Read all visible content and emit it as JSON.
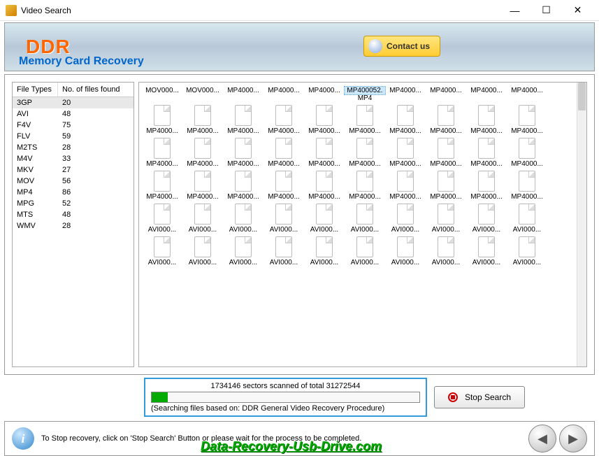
{
  "titlebar": {
    "title": "Video Search"
  },
  "header": {
    "logo": "DDR",
    "subtitle": "Memory Card Recovery",
    "contact": "Contact us"
  },
  "table": {
    "headers": {
      "col1": "File Types",
      "col2": "No. of files found"
    },
    "rows": [
      {
        "type": "3GP",
        "count": "20",
        "selected": true
      },
      {
        "type": "AVI",
        "count": "48"
      },
      {
        "type": "F4V",
        "count": "75"
      },
      {
        "type": "FLV",
        "count": "59"
      },
      {
        "type": "M2TS",
        "count": "28"
      },
      {
        "type": "M4V",
        "count": "33"
      },
      {
        "type": "MKV",
        "count": "27"
      },
      {
        "type": "MOV",
        "count": "56"
      },
      {
        "type": "MP4",
        "count": "86"
      },
      {
        "type": "MPG",
        "count": "52"
      },
      {
        "type": "MTS",
        "count": "48"
      },
      {
        "type": "WMV",
        "count": "28"
      }
    ]
  },
  "files": {
    "selected_full": "MP400052.MP4",
    "rows": [
      [
        "MOV000...",
        "MOV000...",
        "MP4000...",
        "MP4000...",
        "MP4000...",
        "MP400052.",
        "MP4000...",
        "MP4000...",
        "MP4000...",
        "MP4000..."
      ],
      [
        "MP4000...",
        "MP4000...",
        "MP4000...",
        "MP4000...",
        "MP4000...",
        "MP4000...",
        "MP4000...",
        "MP4000...",
        "MP4000...",
        "MP4000..."
      ],
      [
        "MP4000...",
        "MP4000...",
        "MP4000...",
        "MP4000...",
        "MP4000...",
        "MP4000...",
        "MP4000...",
        "MP4000...",
        "MP4000...",
        "MP4000..."
      ],
      [
        "MP4000...",
        "MP4000...",
        "MP4000...",
        "MP4000...",
        "MP4000...",
        "MP4000...",
        "MP4000...",
        "MP4000...",
        "MP4000...",
        "MP4000..."
      ],
      [
        "AVI000...",
        "AVI000...",
        "AVI000...",
        "AVI000...",
        "AVI000...",
        "AVI000...",
        "AVI000...",
        "AVI000...",
        "AVI000...",
        "AVI000..."
      ],
      [
        "AVI000...",
        "AVI000...",
        "AVI000...",
        "AVI000...",
        "AVI000...",
        "AVI000...",
        "AVI000...",
        "AVI000...",
        "AVI000...",
        "AVI000..."
      ]
    ]
  },
  "progress": {
    "scanned_label": "1734146 sectors scanned of total 31272544",
    "note": "(Searching files based on:  DDR General Video Recovery Procedure)",
    "stop": "Stop Search"
  },
  "footer": {
    "text": "To Stop recovery, click on 'Stop Search' Button or please wait for the process to be completed.",
    "watermark": "Data-Recovery-Usb-Drive.com"
  }
}
